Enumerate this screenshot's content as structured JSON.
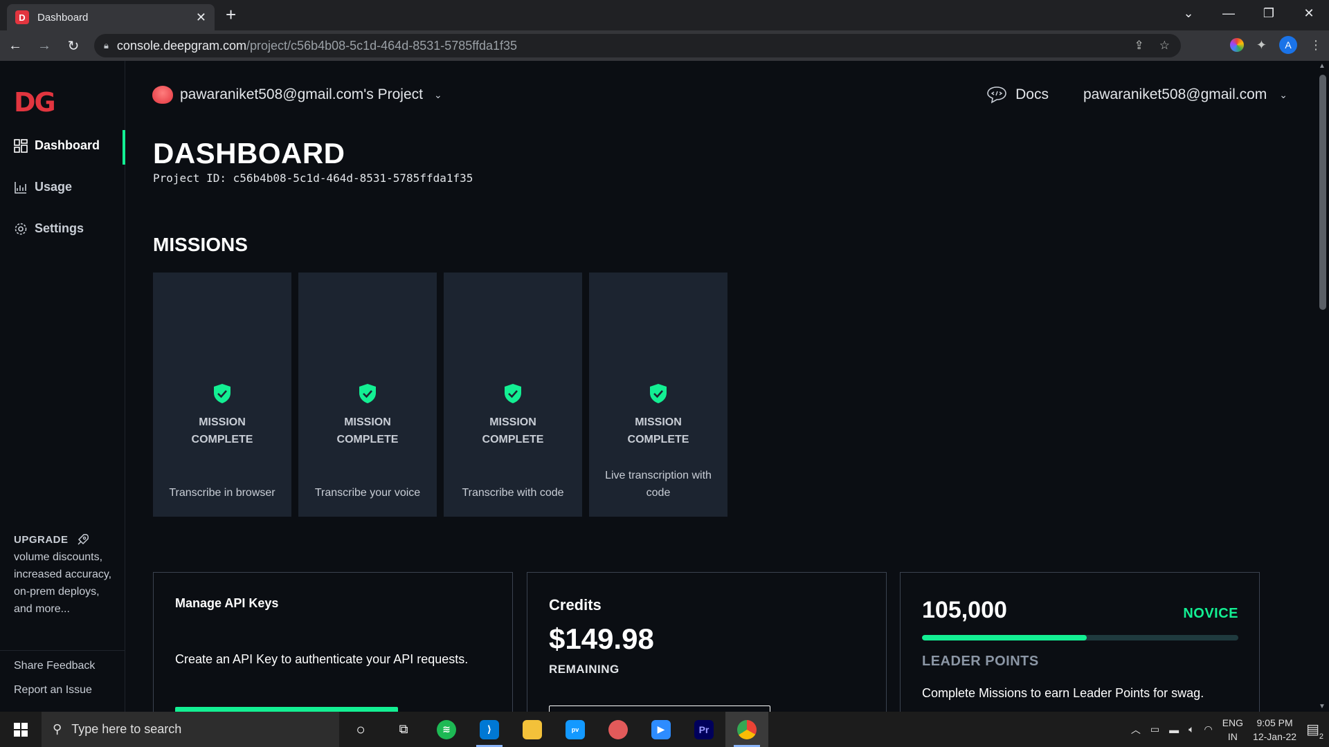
{
  "browser": {
    "tab_title": "Dashboard",
    "url_host": "console.deepgram.com",
    "url_path": "/project/c56b4b08-5c1d-464d-8531-5785ffda1f35",
    "profile_initial": "A"
  },
  "sidebar": {
    "logo": "DG",
    "items": [
      {
        "label": "Dashboard",
        "icon": "grid-icon",
        "active": true
      },
      {
        "label": "Usage",
        "icon": "chart-icon",
        "active": false
      },
      {
        "label": "Settings",
        "icon": "gear-icon",
        "active": false
      }
    ],
    "upgrade_title": "UPGRADE",
    "upgrade_text": "volume discounts, increased accuracy, on-prem deploys, and more...",
    "share_feedback": "Share Feedback",
    "report_issue": "Report an Issue"
  },
  "topbar": {
    "project_name": "pawaraniket508@gmail.com's Project",
    "docs_label": "Docs",
    "account_email": "pawaraniket508@gmail.com"
  },
  "main": {
    "title": "DASHBOARD",
    "project_id": "Project ID: c56b4b08-5c1d-464d-8531-5785ffda1f35",
    "missions_title": "MISSIONS",
    "missions": [
      {
        "status": "MISSION COMPLETE",
        "name": "Transcribe in browser"
      },
      {
        "status": "MISSION COMPLETE",
        "name": "Transcribe your voice"
      },
      {
        "status": "MISSION COMPLETE",
        "name": "Transcribe with code"
      },
      {
        "status": "MISSION COMPLETE",
        "name": "Live transcription with code"
      }
    ]
  },
  "api_keys": {
    "title": "Manage API Keys",
    "description": "Create an API Key to authenticate your API requests."
  },
  "credits": {
    "title": "Credits",
    "amount": "$149.98",
    "remaining_label": "REMAINING"
  },
  "leader_points": {
    "value": "105,000",
    "level": "NOVICE",
    "progress_fraction": 0.52,
    "label": "LEADER POINTS",
    "description": "Complete Missions to earn Leader Points for swag."
  },
  "taskbar": {
    "search_placeholder": "Type here to search",
    "lang_top": "ENG",
    "lang_bottom": "IN",
    "time": "9:05 PM",
    "date": "12-Jan-22",
    "notification_count": "2"
  },
  "colors": {
    "accent": "#13ef93",
    "brand": "#e2353f",
    "card_bg": "#1c2430",
    "page_bg": "#0b0e13"
  }
}
